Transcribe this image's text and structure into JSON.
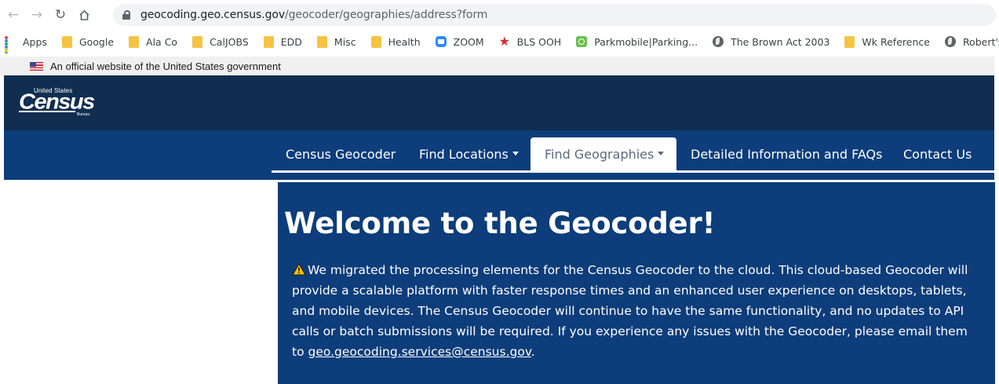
{
  "browser": {
    "url_host": "geocoding.geo.census.gov",
    "url_path": "/geocoder/geographies/address?form",
    "bookmarks": [
      {
        "label": "Apps",
        "icon": "apps-grid-icon"
      },
      {
        "label": "Google",
        "icon": "folder-icon"
      },
      {
        "label": "Ala Co",
        "icon": "folder-icon"
      },
      {
        "label": "CalJOBS",
        "icon": "folder-icon"
      },
      {
        "label": "EDD",
        "icon": "folder-icon"
      },
      {
        "label": "Misc",
        "icon": "folder-icon"
      },
      {
        "label": "Health",
        "icon": "folder-icon"
      },
      {
        "label": "ZOOM",
        "icon": "zoom-icon"
      },
      {
        "label": "BLS OOH",
        "icon": "bls-star-icon"
      },
      {
        "label": "Parkmobile|Parking...",
        "icon": "parkmobile-icon"
      },
      {
        "label": "The Brown Act 2003",
        "icon": "globe-icon"
      },
      {
        "label": "Wk Reference",
        "icon": "folder-icon"
      },
      {
        "label": "Robert's Ru",
        "icon": "globe-icon"
      }
    ]
  },
  "gov_banner": {
    "text": "An official website of the United States government"
  },
  "header": {
    "logo_small": "United States",
    "logo_big": "Census",
    "logo_bureau": "Bureau"
  },
  "nav": {
    "items": [
      {
        "label": "Census Geocoder",
        "dropdown": false
      },
      {
        "label": "Find Locations",
        "dropdown": true
      },
      {
        "label": "Find Geographies",
        "dropdown": true,
        "active": true
      },
      {
        "label": "Detailed Information and FAQs",
        "dropdown": false
      },
      {
        "label": "Contact Us",
        "dropdown": false
      }
    ]
  },
  "main": {
    "title": "Welcome to the Geocoder!",
    "notice_text": "We migrated the processing elements for the Census Geocoder to the cloud. This cloud-based Geocoder will provide a scalable platform with faster response times and an enhanced user experience on desktops, tablets, and mobile devices. The Census Geocoder will continue to have the same functionality, and no updates to API calls or batch submissions will be required. If you experience any issues with the Geocoder, please email them to ",
    "email": "geo.geocoding.services@census.gov",
    "after_email": "."
  },
  "colors": {
    "header_bg": "#112e51",
    "nav_bg": "#0d3d7a",
    "panel_bg": "#0d3d7a",
    "warning_yellow": "#f2c200"
  }
}
